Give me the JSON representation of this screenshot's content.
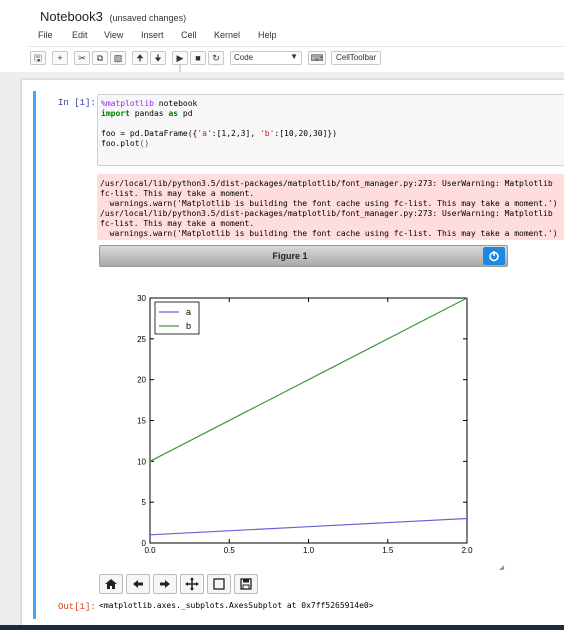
{
  "notebook": {
    "title": "Notebook3",
    "status": "(unsaved changes)"
  },
  "menu": [
    "File",
    "Edit",
    "View",
    "Insert",
    "Cell",
    "Kernel",
    "Help"
  ],
  "toolbar": {
    "cell_type": "Code",
    "celltoolbar_label": "CellToolbar",
    "icons": [
      "save-icon",
      "plus-icon",
      "cut-icon",
      "copy-icon",
      "paste-icon",
      "arrow-up-icon",
      "arrow-down-icon",
      "step-forward-icon",
      "stop-icon",
      "restart-icon",
      "keyboard-icon"
    ]
  },
  "cell": {
    "in_prompt": "In [1]:",
    "out_prompt": "Out[1]:",
    "code": {
      "line1_magic": "%matplotlib",
      "line1_rest": " notebook",
      "line2_kw": "import",
      "line2_mid": " pandas ",
      "line2_kw2": "as",
      "line2_rest": " pd",
      "line4_a": "foo = pd.DataFrame({",
      "line4_s1": "'a'",
      "line4_b": ":[1,2,3], ",
      "line4_s2": "'b'",
      "line4_c": ":[10,20,30]})",
      "line5_a": "foo.plot",
      "line5_paren": "()"
    },
    "stderr": [
      "/usr/local/lib/python3.5/dist-packages/matplotlib/font_manager.py:273: UserWarning: Matplotlib",
      "fc-list. This may take a moment.",
      "  warnings.warn('Matplotlib is building the font cache using fc-list. This may take a moment.')",
      "/usr/local/lib/python3.5/dist-packages/matplotlib/font_manager.py:273: UserWarning: Matplotlib",
      "fc-list. This may take a moment.",
      "  warnings.warn('Matplotlib is building the font cache using fc-list. This may take a moment.')"
    ],
    "output_text": "<matplotlib.axes._subplots.AxesSubplot at 0x7ff5265914e0>"
  },
  "figure": {
    "title": "Figure 1",
    "nav_icons": [
      "home-icon",
      "back-icon",
      "forward-icon",
      "pan-icon",
      "zoom-rect-icon",
      "save-figure-icon"
    ]
  },
  "colors": {
    "cell_border": "#42a5f5",
    "series_a": "#6464d8",
    "series_b": "#3c9a3c",
    "stderr_bg": "#ffdddd"
  },
  "chart_data": {
    "type": "line",
    "x": [
      0.0,
      1.0,
      2.0
    ],
    "series": [
      {
        "name": "a",
        "values": [
          1,
          2,
          3
        ]
      },
      {
        "name": "b",
        "values": [
          10,
          20,
          30
        ]
      }
    ],
    "xlim": [
      0.0,
      2.0
    ],
    "ylim": [
      0,
      30
    ],
    "xticks": [
      "0.0",
      "0.5",
      "1.0",
      "1.5",
      "2.0"
    ],
    "yticks": [
      "0",
      "5",
      "10",
      "15",
      "20",
      "25",
      "30"
    ],
    "legend": "top-left",
    "grid": false
  }
}
